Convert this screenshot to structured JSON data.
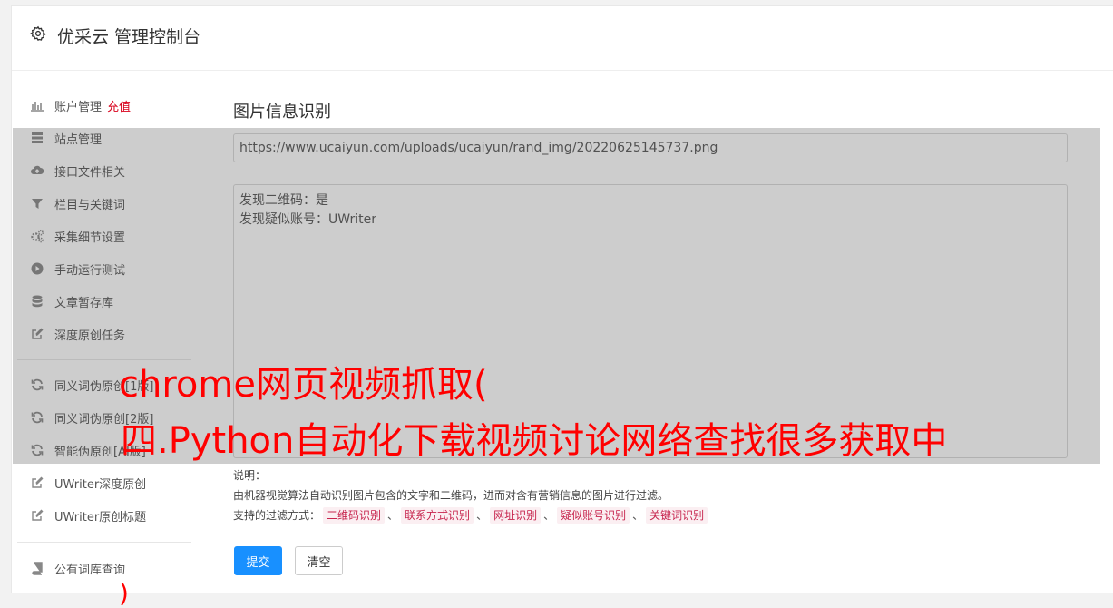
{
  "header": {
    "title": "优采云 管理控制台",
    "icon": "gear-icon"
  },
  "sidebar": {
    "items": [
      {
        "label": "账户管理",
        "badge": "充值",
        "icon": "bar-chart-icon"
      },
      {
        "label": "站点管理",
        "icon": "server-icon"
      },
      {
        "label": "接口文件相关",
        "icon": "cloud-upload-icon"
      },
      {
        "label": "栏目与关键词",
        "icon": "filter-icon"
      },
      {
        "label": "采集细节设置",
        "icon": "cogs-icon"
      },
      {
        "label": "手动运行测试",
        "icon": "play-circle-icon"
      },
      {
        "label": "文章暂存库",
        "icon": "database-icon"
      },
      {
        "label": "深度原创任务",
        "icon": "edit-icon"
      },
      {
        "label": "同义词伪原创[1版]",
        "icon": "refresh-icon"
      },
      {
        "label": "同义词伪原创[2版]",
        "icon": "refresh-icon"
      },
      {
        "label": "智能伪原创[AI版]",
        "icon": "refresh-icon"
      },
      {
        "label": "UWriter深度原创",
        "icon": "edit-icon"
      },
      {
        "label": "UWriter原创标题",
        "icon": "edit-icon"
      },
      {
        "label": "公有词库查询",
        "icon": "book-icon"
      }
    ]
  },
  "main": {
    "title": "图片信息识别",
    "url_value": "https://www.ucaiyun.com/uploads/ucaiyun/rand_img/20220625145737.png",
    "result_text": "发现二维码：是\n发现疑似账号：UWriter",
    "desc_label": "说明：",
    "desc_text": "由机器视觉算法自动识别图片包含的文字和二维码，进而对含有营销信息的图片进行过滤。",
    "filter_label": "支持的过滤方式：",
    "filters": [
      "二维码识别",
      "联系方式识别",
      "网址识别",
      "疑似账号识别",
      "关键词识别"
    ],
    "separator": "、",
    "submit_label": "提交",
    "clear_label": "清空"
  },
  "watermark": {
    "line1": "chrome网页视频抓取(",
    "line2": "四.Python自动化下载视频讨论网络查找很多获取中",
    "line3": ")"
  },
  "colors": {
    "accent": "#1890ff",
    "recharge": "#d9001b",
    "watermark": "#ff0000",
    "tag_text": "#c7254e"
  }
}
